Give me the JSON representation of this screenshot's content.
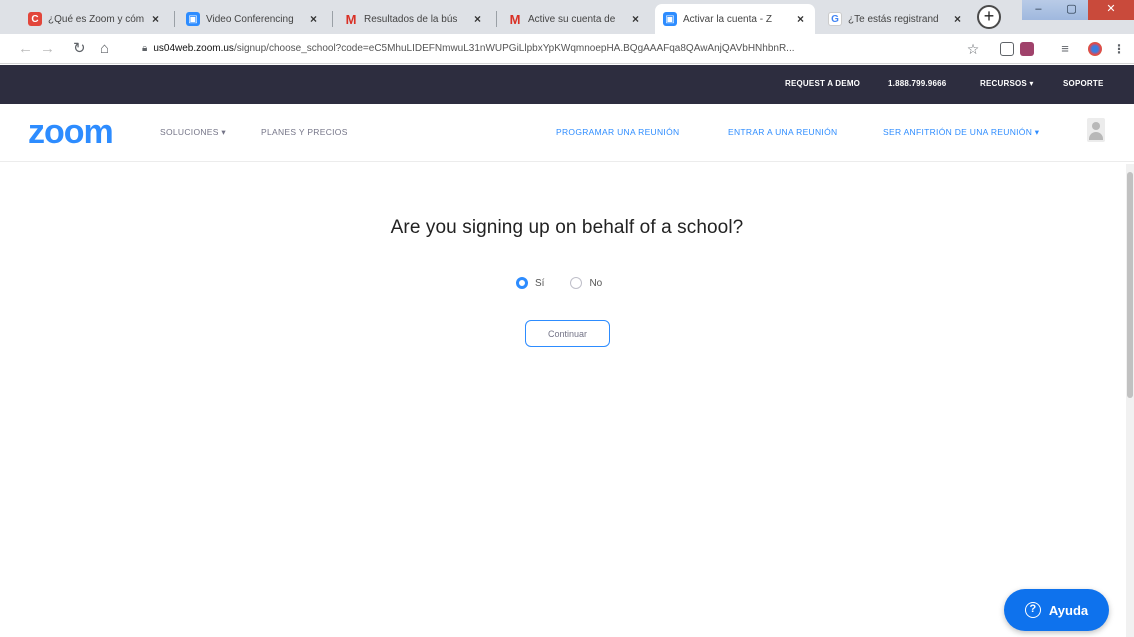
{
  "browser": {
    "tabs": [
      {
        "title": "¿Qué es Zoom y cóm",
        "favicon": "C",
        "color": "#e2463b"
      },
      {
        "title": "Video Conferencing",
        "favicon": "▣",
        "color": "#2d8cff"
      },
      {
        "title": "Resultados de la bús",
        "favicon": "M",
        "color": "#d93025"
      },
      {
        "title": "Active su cuenta de",
        "favicon": "M",
        "color": "#d93025"
      },
      {
        "title": "Activar la cuenta - Z",
        "favicon": "▣",
        "color": "#2d8cff"
      },
      {
        "title": "¿Te estás registrand",
        "favicon": "G",
        "color": "#4285f4"
      }
    ],
    "url_host": "us04web.zoom.us",
    "url_path": "/signup/choose_school?code=eC5MhuLIDEFNmwuL31nWUPGiLlpbxYpKWqmnoepHA.BQgAAAFqa8QAwAnjQAVbHNhbnR..."
  },
  "topbar": {
    "request_demo": "REQUEST A DEMO",
    "phone": "1.888.799.9666",
    "resources": "RECURSOS ▾",
    "support": "SOPORTE"
  },
  "nav": {
    "logo": "zoom",
    "solutions": "SOLUCIONES ▾",
    "plans": "PLANES Y PRECIOS",
    "schedule": "PROGRAMAR UNA REUNIÓN",
    "join": "ENTRAR A UNA REUNIÓN",
    "host": "SER ANFITRIÓN DE UNA REUNIÓN ▾"
  },
  "form": {
    "question": "Are you signing up on behalf of a school?",
    "option_yes": "Sí",
    "option_no": "No",
    "selected": "yes",
    "continue_label": "Continuar"
  },
  "help": {
    "label": "Ayuda"
  },
  "colors": {
    "brand": "#2d8cff",
    "topbar": "#2d2d3f",
    "help": "#0e72ed"
  }
}
